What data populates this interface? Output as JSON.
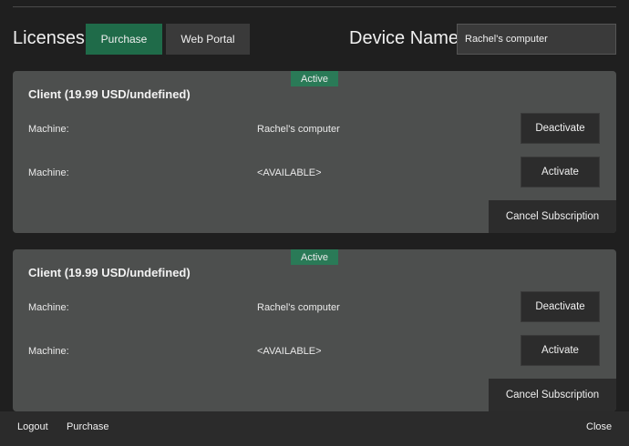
{
  "header": {
    "title": "Licenses",
    "purchase_label": "Purchase",
    "web_portal_label": "Web Portal",
    "device_name_label": "Device Name",
    "device_name_value": "Rachel's computer"
  },
  "licenses": [
    {
      "badge": "Active",
      "title": "Client (19.99 USD/undefined)",
      "machines": [
        {
          "label": "Machine:",
          "value": "Rachel's computer",
          "action": "Deactivate"
        },
        {
          "label": "Machine:",
          "value": "<AVAILABLE>",
          "action": "Activate"
        }
      ],
      "cancel_label": "Cancel Subscription"
    },
    {
      "badge": "Active",
      "title": "Client (19.99 USD/undefined)",
      "machines": [
        {
          "label": "Machine:",
          "value": "Rachel's computer",
          "action": "Deactivate"
        },
        {
          "label": "Machine:",
          "value": "<AVAILABLE>",
          "action": "Activate"
        }
      ],
      "cancel_label": "Cancel Subscription"
    }
  ],
  "footer": {
    "logout_label": "Logout",
    "purchase_label": "Purchase",
    "close_label": "Close"
  },
  "colors": {
    "accent": "#1f6b49",
    "badge": "#2a7a57",
    "card": "#4d4f4e",
    "background": "#1f1f1f"
  }
}
